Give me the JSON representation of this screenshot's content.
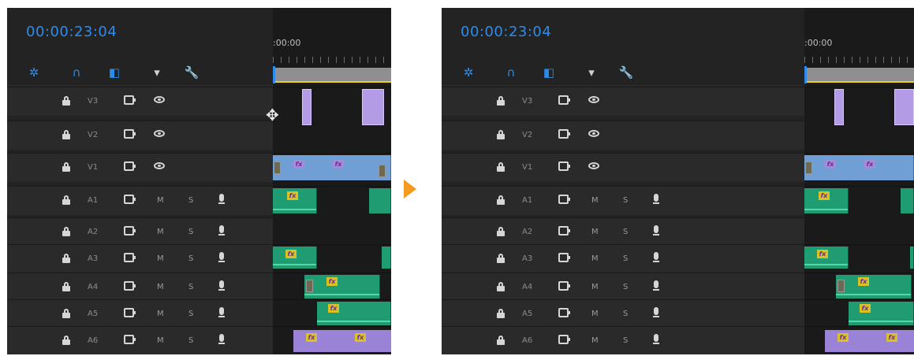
{
  "colors": {
    "timecode": "#2d8ceb",
    "arrow": "#f59b1f",
    "video_clip": "#6f9fd4",
    "audio_clip": "#1f9c72",
    "v3_clip": "#b49be6",
    "fx_badge": "#d7c126",
    "work_area_line": "#e6d41e"
  },
  "before": {
    "timecode": "00:00:23:04",
    "ruler_start": ":00:00",
    "tools": [
      "nest-icon",
      "snap-icon",
      "linked-selection-icon",
      "marker-icon",
      "wrench-icon"
    ]
  },
  "after": {
    "timecode": "00:00:23:04",
    "ruler_start": ":00:00",
    "tools": [
      "nest-icon",
      "snap-icon",
      "linked-selection-icon",
      "marker-icon",
      "wrench-icon"
    ]
  },
  "tracks": [
    {
      "name": "V3",
      "type": "video"
    },
    {
      "name": "V2",
      "type": "video"
    },
    {
      "name": "V1",
      "type": "video"
    },
    {
      "name": "A1",
      "type": "audio",
      "mute": "M",
      "solo": "S"
    },
    {
      "name": "A2",
      "type": "audio",
      "mute": "M",
      "solo": "S"
    },
    {
      "name": "A3",
      "type": "audio",
      "mute": "M",
      "solo": "S"
    },
    {
      "name": "A4",
      "type": "audio",
      "mute": "M",
      "solo": "S"
    },
    {
      "name": "A5",
      "type": "audio",
      "mute": "M",
      "solo": "S"
    },
    {
      "name": "A6",
      "type": "audio",
      "mute": "M",
      "solo": "S"
    }
  ],
  "fx_label": "fx"
}
